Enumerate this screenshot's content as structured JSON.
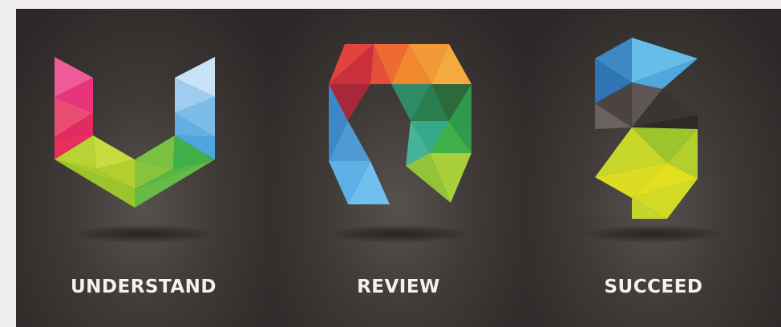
{
  "panels": [
    {
      "label": "UNDERSTAND",
      "logo_icon": "letter-u-geometric-logo"
    },
    {
      "label": "REVIEW",
      "logo_icon": "letter-r-geometric-logo"
    },
    {
      "label": "SUCCEED",
      "logo_icon": "letter-s-geometric-logo"
    }
  ],
  "colors": {
    "background_dark": "#2f2b2a",
    "page_background": "#efeeed",
    "label_text": "#f4f2f0",
    "pink": "#e8347a",
    "light_blue": "#62b4e4",
    "lime": "#b3cf2e",
    "green": "#3fb049",
    "red": "#d93a3a",
    "orange": "#f39a38",
    "teal": "#35a98a",
    "blue": "#3e88c5",
    "yellow": "#e2df1f",
    "gray": "#5d5654"
  }
}
